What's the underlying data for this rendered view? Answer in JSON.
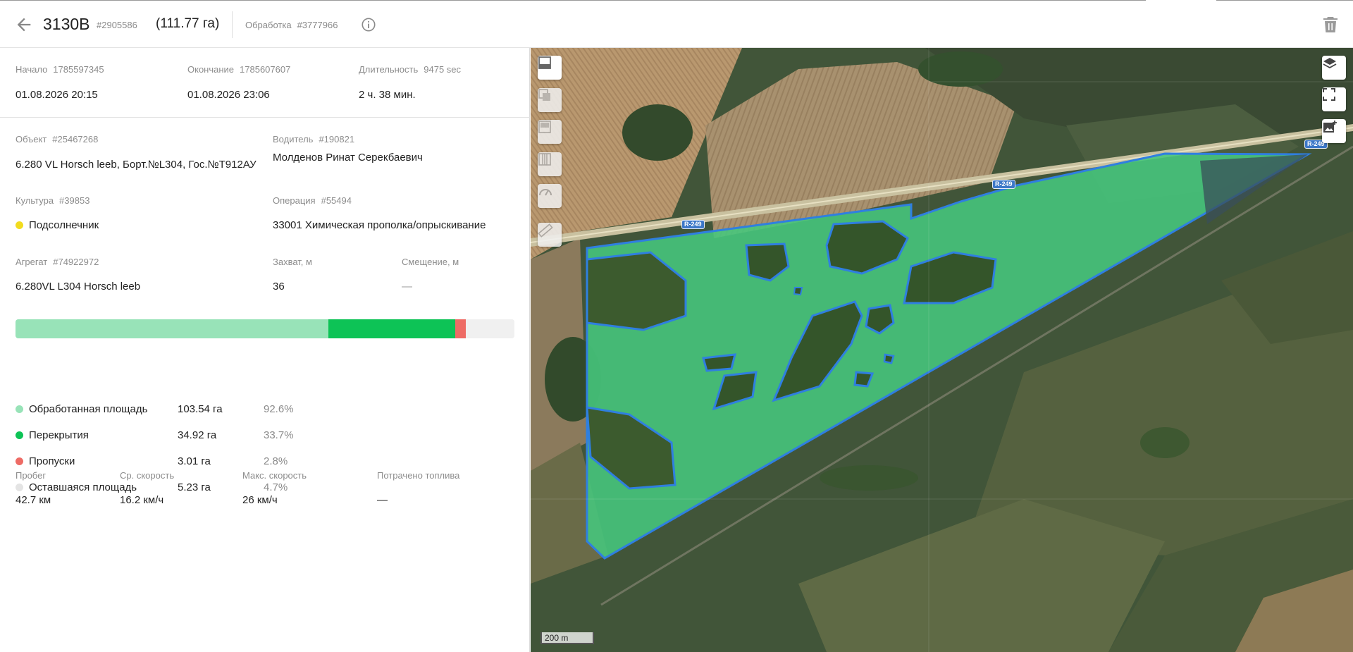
{
  "header": {
    "title": "3130В",
    "title_id": "#2905586",
    "area": "(111.77 га)",
    "processing_label": "Обработка",
    "processing_id": "#3777966"
  },
  "timing": {
    "start_label": "Начало",
    "start_ts": "1785597345",
    "start_value": "01.08.2026 20:15",
    "end_label": "Окончание",
    "end_ts": "1785607607",
    "end_value": "01.08.2026 23:06",
    "duration_label": "Длительность",
    "duration_sec": "9475 sec",
    "duration_value": "2 ч. 38 мин."
  },
  "details": {
    "object_label": "Объект",
    "object_id": "#25467268",
    "object_value": "6.280 VL Horsch leeb, Борт.№L304, Гос.№Т912АУ",
    "driver_label": "Водитель",
    "driver_id": "#190821",
    "driver_value": "Молденов Ринат Серекбаевич",
    "culture_label": "Культура",
    "culture_id": "#39853",
    "culture_value": "Подсолнечник",
    "culture_color": "#f2dc1f",
    "operation_label": "Операция",
    "operation_id": "#55494",
    "operation_value": "33001 Химическая прополка/опрыскивание",
    "aggregate_label": "Агрегат",
    "aggregate_id": "#74922972",
    "aggregate_value": "6.280VL L304 Horsch leeb",
    "width_label": "Захват, м",
    "width_value": "36",
    "offset_label": "Смещение, м",
    "offset_value": "—"
  },
  "coverage": {
    "bar": [
      {
        "name": "processed",
        "fraction": 0.627,
        "color": "#98e3b8"
      },
      {
        "name": "overlap",
        "fraction": 0.254,
        "color": "#0dc356"
      },
      {
        "name": "gaps",
        "fraction": 0.022,
        "color": "#ee6b65"
      },
      {
        "name": "remaining",
        "fraction": 0.097,
        "color": "#f0f0f0"
      }
    ],
    "rows": [
      {
        "label": "Обработанная площадь",
        "ha": "103.54 га",
        "pct": "92.6%",
        "color": "#98e3b8"
      },
      {
        "label": "Перекрытия",
        "ha": "34.92 га",
        "pct": "33.7%",
        "color": "#0dc356"
      },
      {
        "label": "Пропуски",
        "ha": "3.01 га",
        "pct": "2.8%",
        "color": "#ee6b65"
      },
      {
        "label": "Оставшаяся площадь",
        "ha": "5.23 га",
        "pct": "4.7%",
        "color": "#e4e4e4"
      }
    ]
  },
  "stats": {
    "mileage_label": "Пробег",
    "mileage_value": "42.7 км",
    "avg_speed_label": "Ср. скорость",
    "avg_speed_value": "16.2 км/ч",
    "max_speed_label": "Макс. скорость",
    "max_speed_value": "26 км/ч",
    "fuel_label": "Потрачено топлива",
    "fuel_value": "—"
  },
  "map": {
    "road_label": "R-249",
    "scale_label": "200 m"
  }
}
